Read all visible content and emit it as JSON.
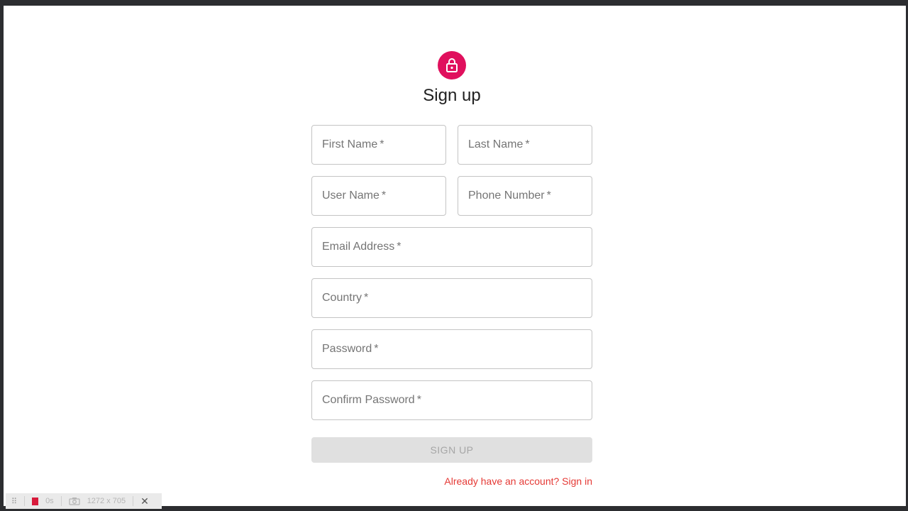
{
  "form": {
    "title": "Sign up",
    "lock_icon": "lock-icon",
    "accent_color": "#e0105d",
    "required_mark": "*",
    "fields": {
      "first_name": "First Name",
      "last_name": "Last Name",
      "user_name": "User Name",
      "phone_number": "Phone Number",
      "email": "Email Address",
      "country": "Country",
      "password": "Password",
      "confirm_password": "Confirm Password"
    },
    "submit_label": "SIGN UP",
    "signin_link": "Already have an account? Sign in"
  },
  "devbar": {
    "timer": "0s",
    "dimensions": "1272 x 705",
    "close": "✕"
  }
}
